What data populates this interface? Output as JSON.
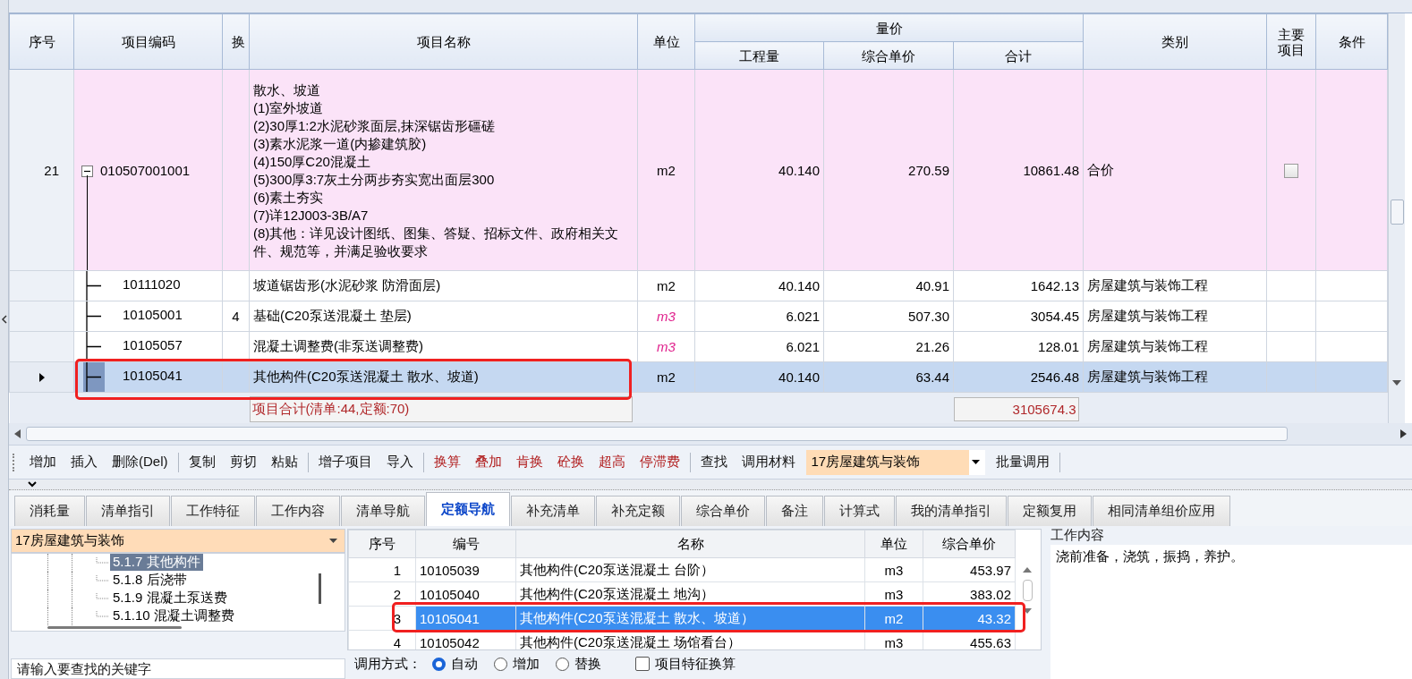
{
  "table": {
    "columns": [
      {
        "label": "序号"
      },
      {
        "label": "项目编码"
      },
      {
        "label": "换"
      },
      {
        "label": "项目名称"
      },
      {
        "label": "单位"
      },
      {
        "label": "量价",
        "children": [
          {
            "label": "工程量"
          },
          {
            "label": "综合单价"
          },
          {
            "label": "合计"
          }
        ]
      },
      {
        "label": "类别"
      },
      {
        "label": "主要项目"
      },
      {
        "label": "条件"
      }
    ],
    "rows": [
      {
        "seq": "21",
        "code": "010507001001",
        "expanded": true,
        "name_lines": [
          "散水、坡道",
          "(1)室外坡道",
          "(2)30厚1:2水泥砂浆面层,抹深锯齿形礓磋",
          "(3)素水泥浆一道(内掺建筑胶)",
          "(4)150厚C20混凝土",
          "(5)300厚3:7灰土分两步夯实宽出面层300",
          "(6)素土夯实",
          "(7)详12J003-3B/A7",
          "(8)其他：详见设计图纸、图集、答疑、招标文件、政府相关文件、规范等，并满足验收要求"
        ],
        "unit": "m2",
        "unit_alert": false,
        "quantity": "40.140",
        "unit_price": "270.59",
        "total": "10861.48",
        "category": "合价",
        "main_item": false,
        "children": [
          {
            "code": "10111020",
            "name": "坡道锯齿形(水泥砂浆 防滑面层)",
            "unit": "m2",
            "unit_alert": false,
            "quantity": "40.140",
            "unit_price": "40.91",
            "total": "1642.13",
            "category": "房屋建筑与装饰工程",
            "selected": false
          },
          {
            "code": "10105001",
            "swap": "4",
            "name": "基础(C20泵送混凝土 垫层)",
            "unit": "m3",
            "unit_alert": true,
            "quantity": "6.021",
            "unit_price": "507.30",
            "total": "3054.45",
            "category": "房屋建筑与装饰工程",
            "selected": false
          },
          {
            "code": "10105057",
            "name": "混凝土调整费(非泵送调整费)",
            "unit": "m3",
            "unit_alert": true,
            "quantity": "6.021",
            "unit_price": "21.26",
            "total": "128.01",
            "category": "房屋建筑与装饰工程",
            "selected": false
          },
          {
            "code": "10105041",
            "name": "其他构件(C20泵送混凝土 散水、坡道)",
            "unit": "m2",
            "unit_alert": false,
            "quantity": "40.140",
            "unit_price": "63.44",
            "total": "2546.48",
            "category": "房屋建筑与装饰工程",
            "selected": true
          }
        ]
      }
    ],
    "summary": {
      "label": "项目合计(清单:44,定额:70)",
      "total": "3105674.3"
    }
  },
  "toolbar": {
    "groups": [
      {
        "items": [
          {
            "kind": "button",
            "label": "增加",
            "emphasis": false
          },
          {
            "kind": "button",
            "label": "插入",
            "emphasis": false
          },
          {
            "kind": "button",
            "label": "删除(Del)",
            "emphasis": false
          }
        ]
      },
      {
        "items": [
          {
            "kind": "button",
            "label": "复制",
            "emphasis": false
          },
          {
            "kind": "button",
            "label": "剪切",
            "emphasis": false
          },
          {
            "kind": "button",
            "label": "粘贴",
            "emphasis": false
          }
        ]
      },
      {
        "items": [
          {
            "kind": "button",
            "label": "增子项目",
            "emphasis": false
          },
          {
            "kind": "button",
            "label": "导入",
            "emphasis": false
          }
        ]
      },
      {
        "items": [
          {
            "kind": "button",
            "label": "换算",
            "emphasis": true
          },
          {
            "kind": "button",
            "label": "叠加",
            "emphasis": true
          },
          {
            "kind": "button",
            "label": "肯换",
            "emphasis": true
          },
          {
            "kind": "button",
            "label": "砼换",
            "emphasis": true
          },
          {
            "kind": "button",
            "label": "超高",
            "emphasis": true
          },
          {
            "kind": "button",
            "label": "停滞费",
            "emphasis": true
          }
        ]
      },
      {
        "items": [
          {
            "kind": "button",
            "label": "查找",
            "emphasis": false
          },
          {
            "kind": "button",
            "label": "调用材料",
            "emphasis": false
          },
          {
            "kind": "select",
            "label": "17房屋建筑与装饰"
          },
          {
            "kind": "button",
            "label": "批量调用",
            "emphasis": false
          }
        ]
      }
    ]
  },
  "tabs": [
    {
      "label": "消耗量",
      "selected": false
    },
    {
      "label": "清单指引",
      "selected": false
    },
    {
      "label": "工作特征",
      "selected": false
    },
    {
      "label": "工作内容",
      "selected": false
    },
    {
      "label": "清单导航",
      "selected": false
    },
    {
      "label": "定额导航",
      "selected": true
    },
    {
      "label": "补充清单",
      "selected": false
    },
    {
      "label": "补充定额",
      "selected": false
    },
    {
      "label": "综合单价",
      "selected": false
    },
    {
      "label": "备注",
      "selected": false
    },
    {
      "label": "计算式",
      "selected": false
    },
    {
      "label": "我的清单指引",
      "selected": false
    },
    {
      "label": "定额复用",
      "selected": false
    },
    {
      "label": "相同清单组价应用",
      "selected": false
    }
  ],
  "quota_panel": {
    "library_select": {
      "value": "17房屋建筑与装饰"
    },
    "tree": [
      {
        "label": "5.1.7 其他构件",
        "selected": true
      },
      {
        "label": "5.1.8 后浇带",
        "selected": false
      },
      {
        "label": "5.1.9 混凝土泵送费",
        "selected": false
      },
      {
        "label": "5.1.10 混凝土调整费",
        "selected": false
      }
    ],
    "search": {
      "placeholder": "请输入要查找的关键字"
    },
    "table": {
      "columns": [
        "序号",
        "编号",
        "名称",
        "单位",
        "综合单价"
      ],
      "rows": [
        {
          "seq": "1",
          "code": "10105039",
          "name": "其他构件(C20泵送混凝土 台阶）",
          "unit": "m3",
          "unit_price": "453.97",
          "selected": false
        },
        {
          "seq": "2",
          "code": "10105040",
          "name": "其他构件(C20泵送混凝土 地沟）",
          "unit": "m3",
          "unit_price": "383.02",
          "selected": false
        },
        {
          "seq": "3",
          "code": "10105041",
          "name": "其他构件(C20泵送混凝土 散水、坡道）",
          "unit": "m2",
          "unit_price": "43.32",
          "selected": true
        },
        {
          "seq": "4",
          "code": "10105042",
          "name": "其他构件(C20泵送混凝土 场馆看台）",
          "unit": "m3",
          "unit_price": "455.63",
          "selected": false
        }
      ]
    },
    "call_mode": {
      "label": "调用方式：",
      "options": [
        {
          "label": "自动",
          "selected": true
        },
        {
          "label": "增加",
          "selected": false
        },
        {
          "label": "替换",
          "selected": false
        }
      ]
    },
    "feature_convert": {
      "label": "项目特征换算",
      "checked": false
    },
    "work_content": {
      "title": "工作内容",
      "text": "浇前准备，浇筑，振捣，养护。"
    }
  }
}
